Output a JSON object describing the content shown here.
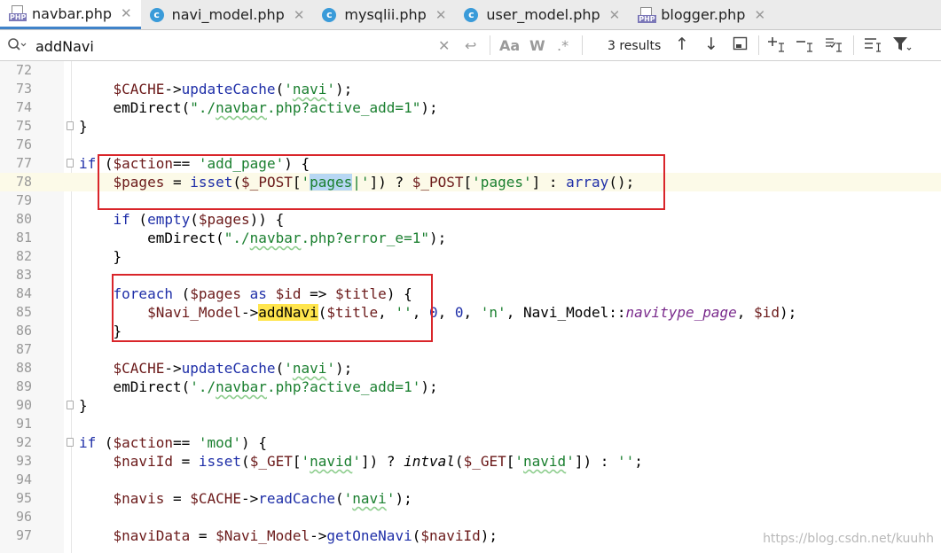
{
  "tabs": [
    {
      "name": "navbar.php",
      "icon": "php-file-icon",
      "active": true
    },
    {
      "name": "navi_model.php",
      "icon": "class-icon",
      "active": false
    },
    {
      "name": "mysqlii.php",
      "icon": "class-icon",
      "active": false
    },
    {
      "name": "user_model.php",
      "icon": "class-icon",
      "active": false
    },
    {
      "name": "blogger.php",
      "icon": "php-file-icon",
      "active": false
    }
  ],
  "search": {
    "query": "addNavi",
    "results_label": "3 results",
    "toggles": {
      "match_case": "Aa",
      "words": "W",
      "regex": ".*"
    }
  },
  "colors": {
    "accent": "#4083c9",
    "highlight_box": "#d9252a",
    "match": "#ffe54d",
    "current_line": "#fcfae8"
  },
  "editor": {
    "current_line": 78,
    "lines": [
      {
        "n": "72"
      },
      {
        "n": "73"
      },
      {
        "n": "74"
      },
      {
        "n": "75"
      },
      {
        "n": "76"
      },
      {
        "n": "77"
      },
      {
        "n": "78"
      },
      {
        "n": "79"
      },
      {
        "n": "80"
      },
      {
        "n": "81"
      },
      {
        "n": "82"
      },
      {
        "n": "83"
      },
      {
        "n": "84"
      },
      {
        "n": "85"
      },
      {
        "n": "86"
      },
      {
        "n": "87"
      },
      {
        "n": "88"
      },
      {
        "n": "89"
      },
      {
        "n": "90"
      },
      {
        "n": "91"
      },
      {
        "n": "92"
      },
      {
        "n": "93"
      },
      {
        "n": "94"
      },
      {
        "n": "95"
      },
      {
        "n": "96"
      },
      {
        "n": "97"
      }
    ]
  },
  "watermark": "https://blog.csdn.net/kuuhh"
}
